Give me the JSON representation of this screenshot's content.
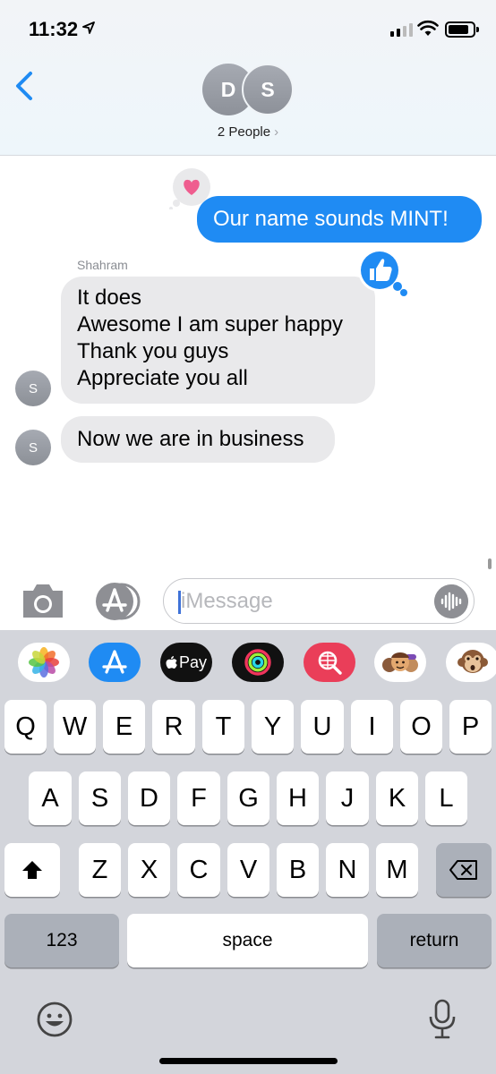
{
  "status_bar": {
    "time": "11:32"
  },
  "header": {
    "avatars": [
      "D",
      "S"
    ],
    "participants": "2 People",
    "chevron": "›"
  },
  "messages": {
    "outgoing": {
      "text": "Our name sounds MINT!",
      "tapback": "heart-icon",
      "tapback_color": "#ef5d8f"
    },
    "sender_name": "Shahram",
    "incoming_1": {
      "lines": [
        "It does",
        "Awesome I am super happy",
        "Thank you guys",
        "Appreciate you all"
      ],
      "tapback": "thumbs-up-icon",
      "avatar": "S"
    },
    "incoming_2": {
      "text": "Now we are in business",
      "avatar": "S"
    }
  },
  "compose": {
    "placeholder": "iMessage"
  },
  "app_strip": [
    "Photos",
    "App Store",
    "Apple Pay",
    "Activity",
    "Search Images",
    "Memoji",
    "Animoji"
  ],
  "app_strip_labels": {
    "apple_pay": "Pay"
  },
  "keyboard": {
    "row1": [
      "Q",
      "W",
      "E",
      "R",
      "T",
      "Y",
      "U",
      "I",
      "O",
      "P"
    ],
    "row2": [
      "A",
      "S",
      "D",
      "F",
      "G",
      "H",
      "J",
      "K",
      "L"
    ],
    "row3": [
      "Z",
      "X",
      "C",
      "V",
      "B",
      "N",
      "M"
    ],
    "numbers_label": "123",
    "space_label": "space",
    "return_label": "return"
  },
  "colors": {
    "outgoing_bubble": "#1f8bf3",
    "incoming_bubble": "#e9e9eb",
    "accent": "#1f8bf3",
    "keyboard_bg": "#d3d5db"
  }
}
